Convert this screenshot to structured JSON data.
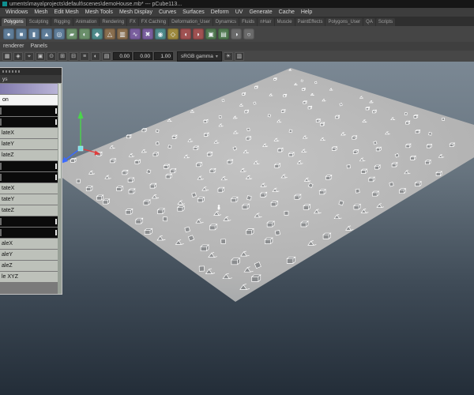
{
  "window": {
    "title": "uments\\maya\\projects\\default\\scenes\\demoHouse.mb* ---  pCube113..."
  },
  "menu_bar": {
    "items": [
      "Windows",
      "Mesh",
      "Edit Mesh",
      "Mesh Tools",
      "Mesh Display",
      "Curves",
      "Surfaces",
      "Deform",
      "UV",
      "Generate",
      "Cache",
      "Help"
    ]
  },
  "shelf_tabs": {
    "active": "Polygons",
    "tabs": [
      "Polygons",
      "Sculpting",
      "Rigging",
      "Animation",
      "Rendering",
      "FX",
      "FX Caching",
      "Deformation_User",
      "Dynamics",
      "Fluids",
      "nHair",
      "Muscle",
      "PaintEffects",
      "Polygons_User",
      "QA",
      "Scripts"
    ]
  },
  "shelf_icons": [
    {
      "name": "sphere-primitive-icon",
      "color": "#5f7d99",
      "glyph": "●"
    },
    {
      "name": "cube-primitive-icon",
      "color": "#5f7d99",
      "glyph": "■"
    },
    {
      "name": "cylinder-primitive-icon",
      "color": "#5f7d99",
      "glyph": "▮"
    },
    {
      "name": "cone-primitive-icon",
      "color": "#5f7d99",
      "glyph": "▲"
    },
    {
      "name": "torus-primitive-icon",
      "color": "#5f7d99",
      "glyph": "◎"
    },
    {
      "name": "plane-primitive-icon",
      "color": "#6a8f6a",
      "glyph": "▰"
    },
    {
      "name": "disc-primitive-icon",
      "color": "#6a8f6a",
      "glyph": "◐"
    },
    {
      "name": "platonic-primitive-icon",
      "color": "#4f8a8a",
      "glyph": "◆"
    },
    {
      "name": "pyramid-primitive-icon",
      "color": "#8a6f4f",
      "glyph": "△"
    },
    {
      "name": "pipe-primitive-icon",
      "color": "#8a6f4f",
      "glyph": "▥"
    },
    {
      "name": "helix-primitive-icon",
      "color": "#7a5f9e",
      "glyph": "∿"
    },
    {
      "name": "gear-primitive-icon",
      "color": "#7a5f9e",
      "glyph": "✖"
    },
    {
      "name": "soccerball-primitive-icon",
      "color": "#4f8a8a",
      "glyph": "◉"
    },
    {
      "name": "superellipse-primitive-icon",
      "color": "#9e8a3f",
      "glyph": "◇"
    },
    {
      "name": "boolean-union-icon",
      "color": "#a05252",
      "glyph": "◖"
    },
    {
      "name": "boolean-difference-icon",
      "color": "#a05252",
      "glyph": "◗"
    },
    {
      "name": "combine-icon",
      "color": "#527a52",
      "glyph": "▣"
    },
    {
      "name": "separate-icon",
      "color": "#527a52",
      "glyph": "▤"
    },
    {
      "name": "extract-icon",
      "color": "#6b6b6b",
      "glyph": "◑"
    },
    {
      "name": "fill-hole-icon",
      "color": "#6b6b6b",
      "glyph": "○"
    }
  ],
  "panel_menus": {
    "items": [
      "renderer",
      "Panels"
    ]
  },
  "viewport_toolbar": {
    "left_icons": [
      {
        "name": "grid-snap-icon",
        "glyph": "▦"
      },
      {
        "name": "curve-snap-icon",
        "glyph": "◈"
      },
      {
        "name": "point-snap-icon",
        "glyph": "⌖"
      },
      {
        "name": "view-plane-snap-icon",
        "glyph": "▣"
      },
      {
        "name": "make-live-icon",
        "glyph": "⊙"
      },
      {
        "name": "input-connections-icon",
        "glyph": "⊞"
      },
      {
        "name": "output-connections-icon",
        "glyph": "⊟"
      },
      {
        "name": "history-icon",
        "glyph": "≡"
      },
      {
        "name": "camera-icon",
        "glyph": "◐"
      },
      {
        "name": "bookmark-icon",
        "glyph": "▤"
      }
    ],
    "fields": [
      {
        "name": "coord-x-field",
        "value": "0.00"
      },
      {
        "name": "coord-y-field",
        "value": "0.00"
      },
      {
        "name": "coord-z-field",
        "value": "1.00"
      }
    ],
    "gamma_label": "sRGB gamma",
    "caret_glyph": "▾",
    "right_icons": [
      {
        "name": "exposure-icon",
        "glyph": "☀"
      },
      {
        "name": "view-transform-icon",
        "glyph": "▥"
      }
    ]
  },
  "channel_panel": {
    "header": "ys",
    "rows": [
      {
        "type": "group",
        "text": ""
      },
      {
        "type": "selected",
        "text": "on"
      },
      {
        "type": "slider"
      },
      {
        "type": "slider"
      },
      {
        "type": "field",
        "text": "lateX"
      },
      {
        "type": "field",
        "text": "lateY"
      },
      {
        "type": "field",
        "text": "lateZ"
      },
      {
        "type": "slider"
      },
      {
        "type": "slider"
      },
      {
        "type": "field",
        "text": "tateX"
      },
      {
        "type": "field",
        "text": "tateY"
      },
      {
        "type": "field",
        "text": "tateZ"
      },
      {
        "type": "slider"
      },
      {
        "type": "slider"
      },
      {
        "type": "field",
        "text": "aleX"
      },
      {
        "type": "field",
        "text": "aleY"
      },
      {
        "type": "field",
        "text": "aleZ"
      },
      {
        "type": "field",
        "text": "le XYZ"
      }
    ]
  },
  "viewport": {
    "bg_top": "#7b8894",
    "bg_bottom": "#232d38",
    "plane_color": "#b3b3b3",
    "wire_color": "#ffffff",
    "grid": 15,
    "manipulator": {
      "axis_y_color": "#4ad54a",
      "axis_z_color": "#3b6bff",
      "axis_x_color": "#e03c3c",
      "center_color": "#79e0e8"
    }
  }
}
